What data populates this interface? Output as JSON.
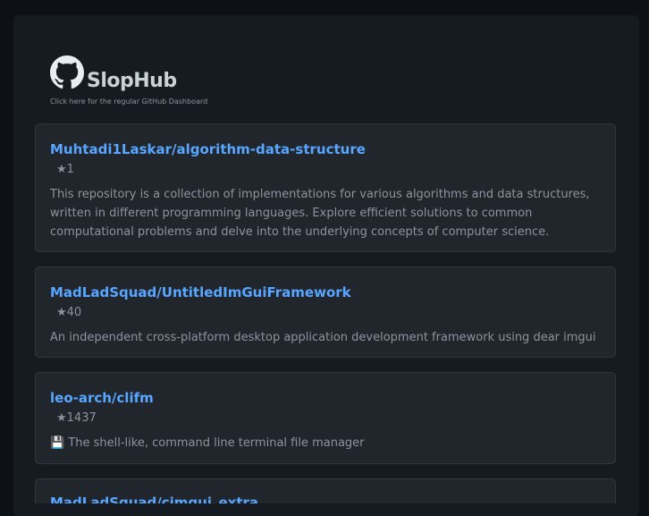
{
  "header": {
    "title": "SlopHub",
    "subtitle_link": "Click here for the regular GitHub Dashboard",
    "logo_icon": "github-octocat-icon"
  },
  "colors": {
    "background": "#0d1117",
    "panel": "#161b22",
    "card": "#21262d",
    "link": "#58a6ff",
    "muted_text": "#8b949e"
  },
  "repos": [
    {
      "name": "Muhtadi1Laskar/algorithm-data-structure",
      "stars": "★1",
      "description": "This repository is a collection of implementations for various algorithms and data structures, written in different programming languages. Explore efficient solutions to common computational problems and delve into the underlying concepts of computer science."
    },
    {
      "name": "MadLadSquad/UntitledImGuiFramework",
      "stars": "★40",
      "description": "An independent cross-platform desktop application development framework using dear imgui"
    },
    {
      "name": "leo-arch/clifm",
      "stars": "★1437",
      "description": "💾 The shell-like, command line terminal file manager"
    },
    {
      "name": "MadLadSquad/cimgui_extra",
      "stars": "",
      "description": ""
    }
  ]
}
